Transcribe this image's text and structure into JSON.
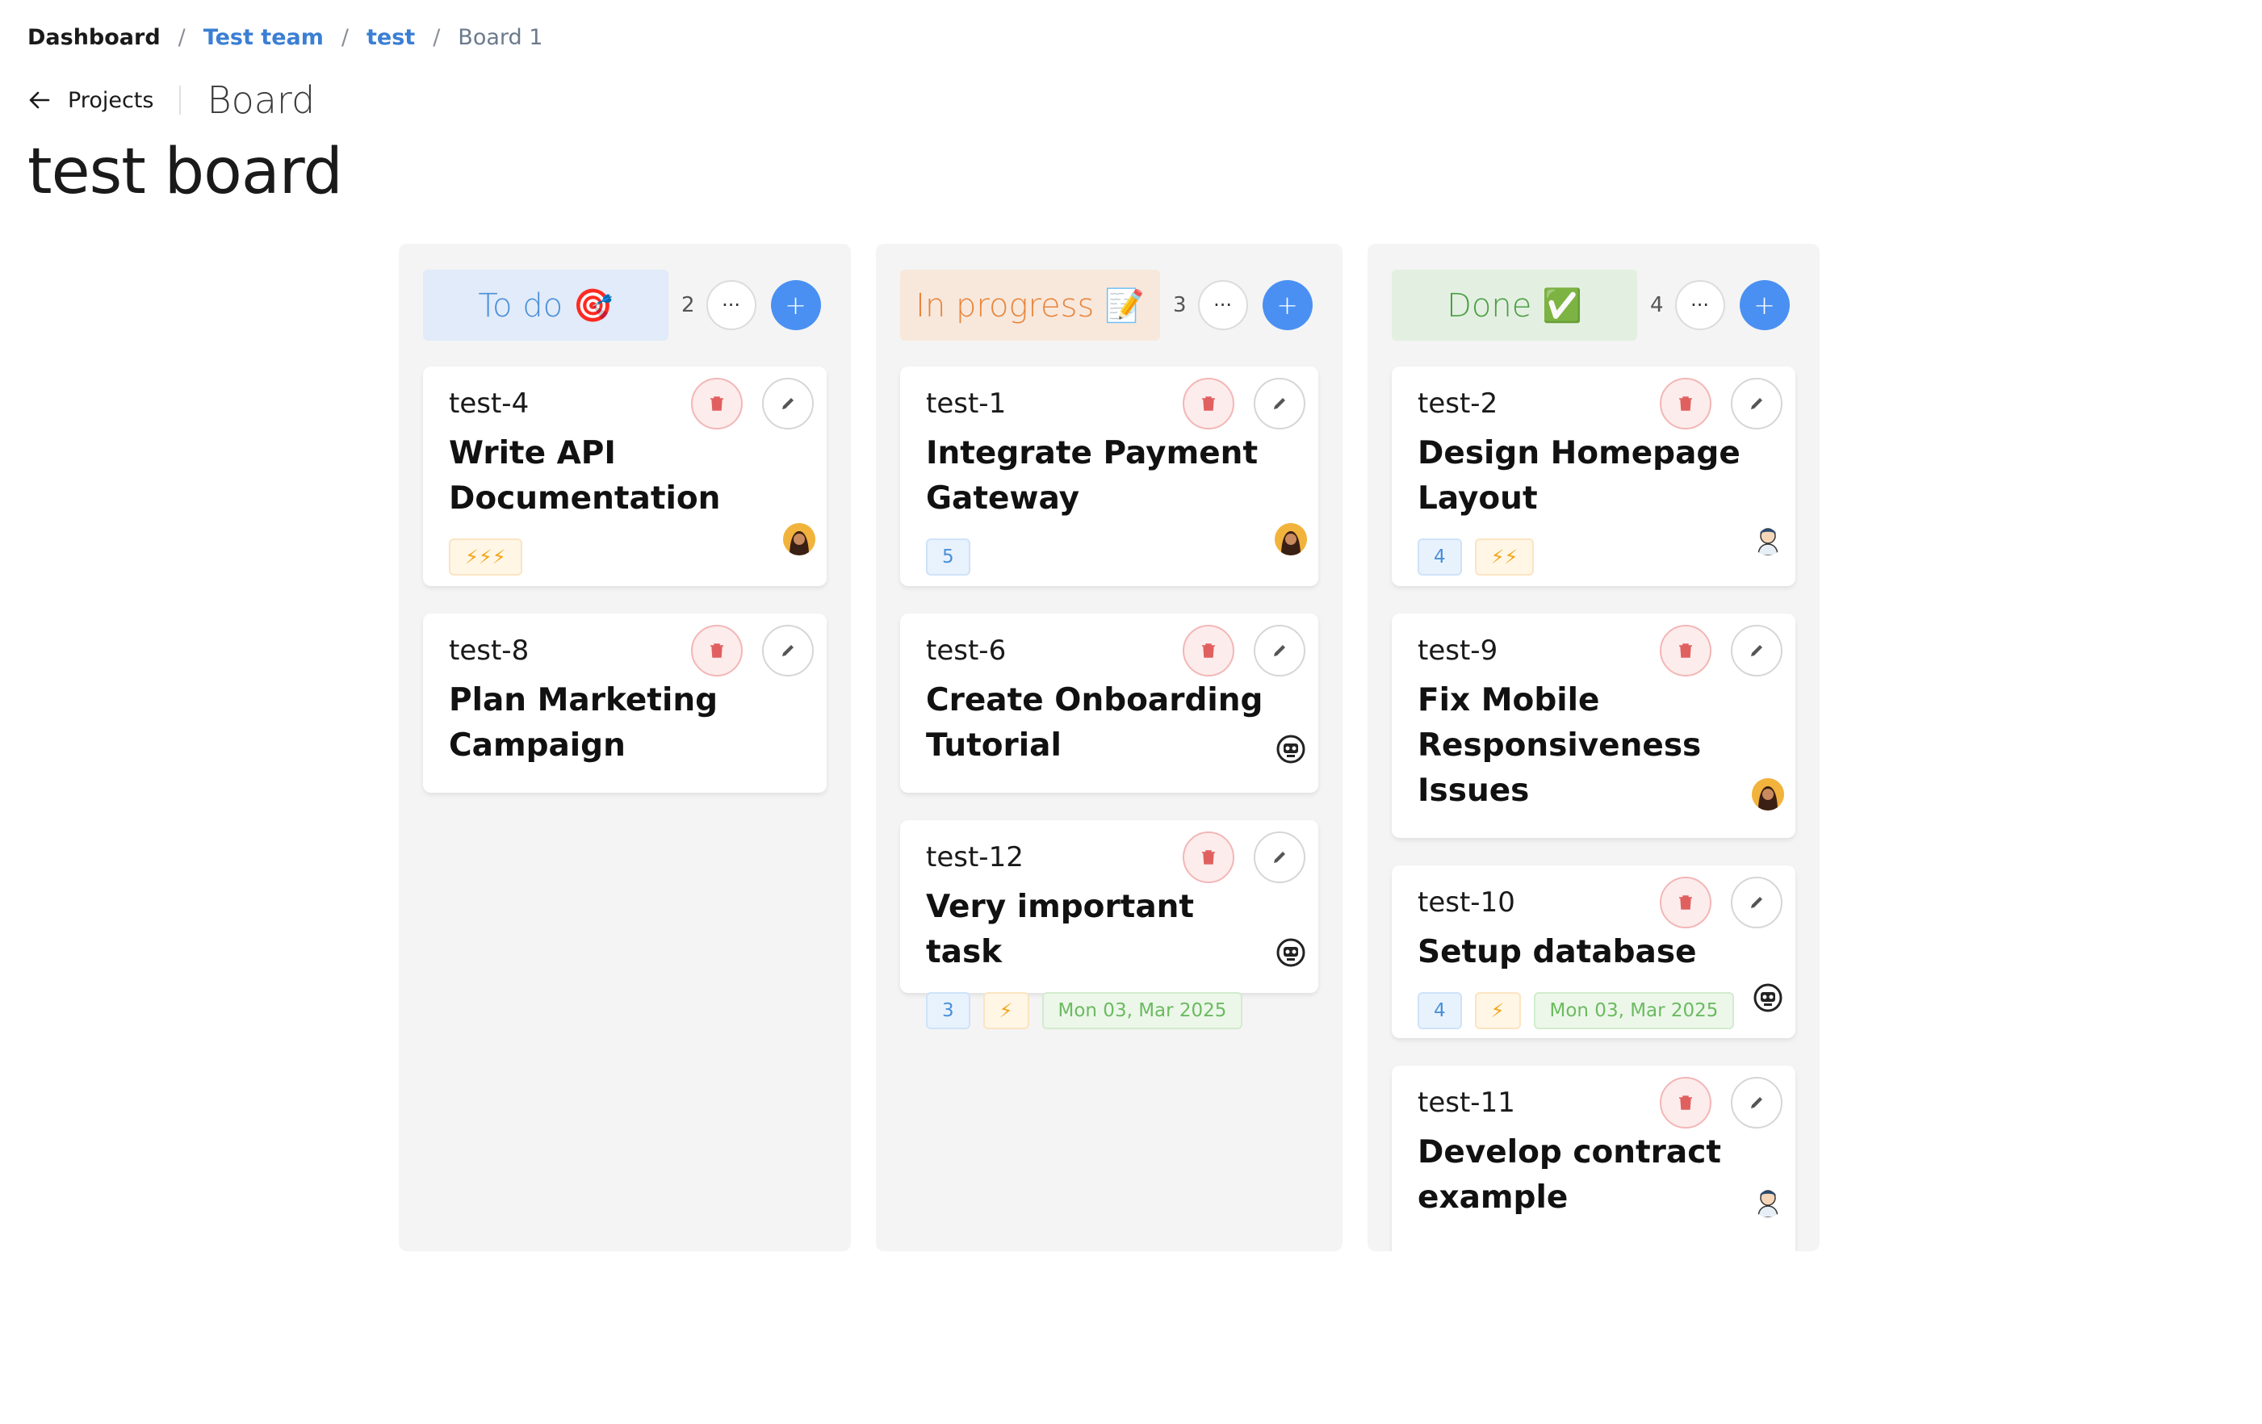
{
  "breadcrumb": {
    "items": [
      "Dashboard",
      "Test team",
      "test",
      "Board 1"
    ],
    "separator": "/"
  },
  "header": {
    "back_label": "Projects",
    "section": "Board",
    "title": "test board"
  },
  "colors": {
    "accent": "#4a90f2",
    "todo_bg": "#e1ebf9",
    "todo_text": "#4a8fd8",
    "inprogress_bg": "#f8e8dc",
    "inprogress_text": "#e8853c",
    "done_bg": "#e3f0e1",
    "done_text": "#4d9e45"
  },
  "columns": [
    {
      "title": "To do 🎯",
      "count": "2",
      "cards": [
        {
          "id": "test-4",
          "title": "Write API Documentation",
          "tags": {
            "priority": "⚡⚡⚡"
          },
          "avatar": "woman-avatar"
        },
        {
          "id": "test-8",
          "title": "Plan Marketing Campaign",
          "tags": {},
          "avatar": ""
        }
      ]
    },
    {
      "title": "In progress 📝",
      "count": "3",
      "cards": [
        {
          "id": "test-1",
          "title": "Integrate Payment Gateway",
          "tags": {
            "number": "5"
          },
          "avatar": "woman-avatar"
        },
        {
          "id": "test-6",
          "title": "Create Onboarding Tutorial",
          "tags": {},
          "avatar": "robot-avatar"
        },
        {
          "id": "test-12",
          "title": "Very important task",
          "tags": {
            "number": "3",
            "priority": "⚡",
            "date": "Mon 03, Mar 2025"
          },
          "avatar": "robot-avatar"
        }
      ]
    },
    {
      "title": "Done ✅",
      "count": "4",
      "cards": [
        {
          "id": "test-2",
          "title": "Design Homepage Layout",
          "tags": {
            "number": "4",
            "priority": "⚡⚡"
          },
          "avatar": "man-avatar"
        },
        {
          "id": "test-9",
          "title": "Fix Mobile Responsiveness Issues",
          "tags": {},
          "avatar": "woman-avatar"
        },
        {
          "id": "test-10",
          "title": "Setup database",
          "tags": {
            "number": "4",
            "priority": "⚡",
            "date": "Mon 03, Mar 2025"
          },
          "avatar": "robot-avatar"
        },
        {
          "id": "test-11",
          "title": "Develop contract example",
          "tags": {},
          "avatar": "man-avatar"
        }
      ]
    }
  ],
  "icons": {
    "more": "···",
    "add": "+",
    "delete": "trash-icon",
    "edit": "pencil-icon",
    "back": "arrow-left-icon"
  }
}
